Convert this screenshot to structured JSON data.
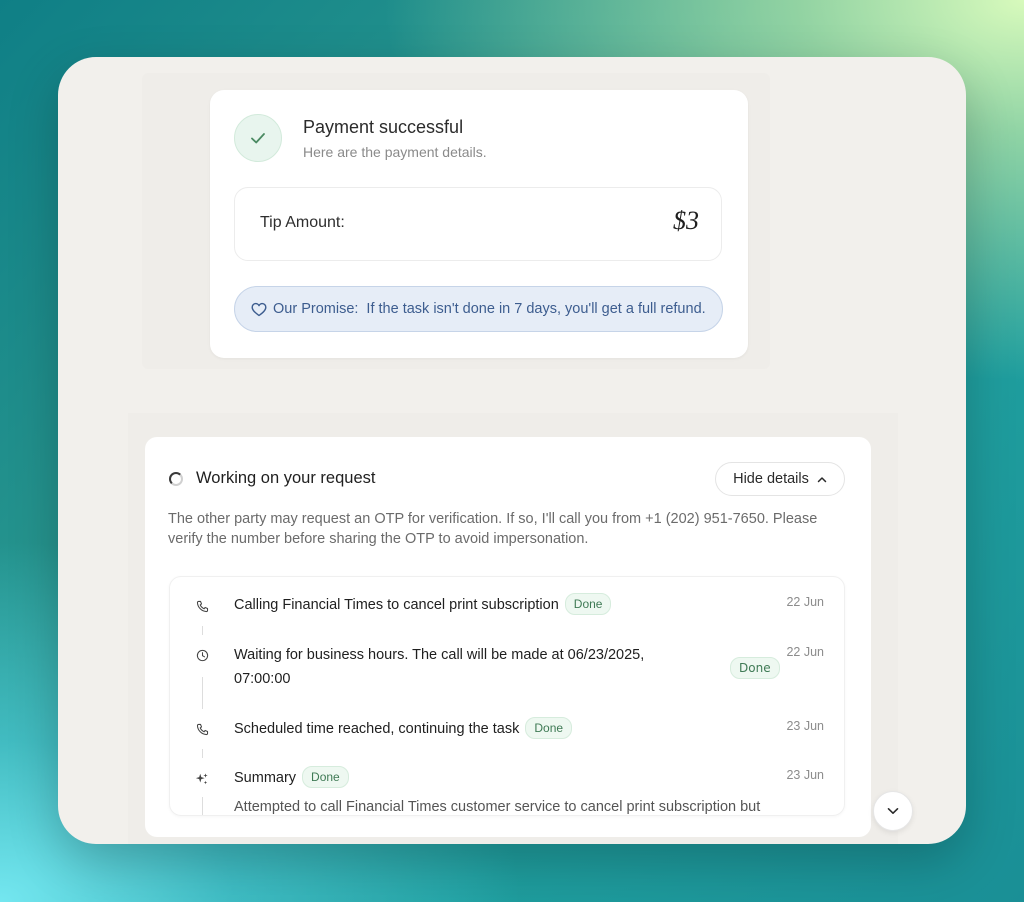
{
  "payment": {
    "title": "Payment successful",
    "subtitle": "Here are the payment details.",
    "tip_label": "Tip Amount:",
    "tip_value": "$3",
    "promise_label": "Our Promise:",
    "promise_text": "If the task isn't done in 7 days, you'll get a full refund."
  },
  "task": {
    "title": "Working on your request",
    "hide_details_label": "Hide details",
    "description": "The other party may request an OTP for verification. If so, I'll call you from +1 (202) 951-7650. Please verify the number before sharing the OTP to avoid impersonation.",
    "steps": [
      {
        "icon": "phone-icon",
        "text": "Calling Financial Times to cancel print subscription",
        "status": "Done",
        "date": "22 Jun"
      },
      {
        "icon": "clock-icon",
        "text": "Waiting for business hours. The call will be made at 06/23/2025, 07:00:00",
        "status": "Done",
        "date": "22 Jun"
      },
      {
        "icon": "phone-icon",
        "text": "Scheduled time reached, continuing the task",
        "status": "Done",
        "date": "23 Jun"
      },
      {
        "icon": "sparkle-icon",
        "text": "Summary",
        "status": "Done",
        "date": "23 Jun"
      }
    ],
    "summary_text": "Attempted to call Financial Times customer service to cancel print subscription but"
  },
  "colors": {
    "accent_green": "#3f7a55",
    "promise_blue": "#3d5d8f",
    "avatar_bg": "#1f3a2d"
  }
}
